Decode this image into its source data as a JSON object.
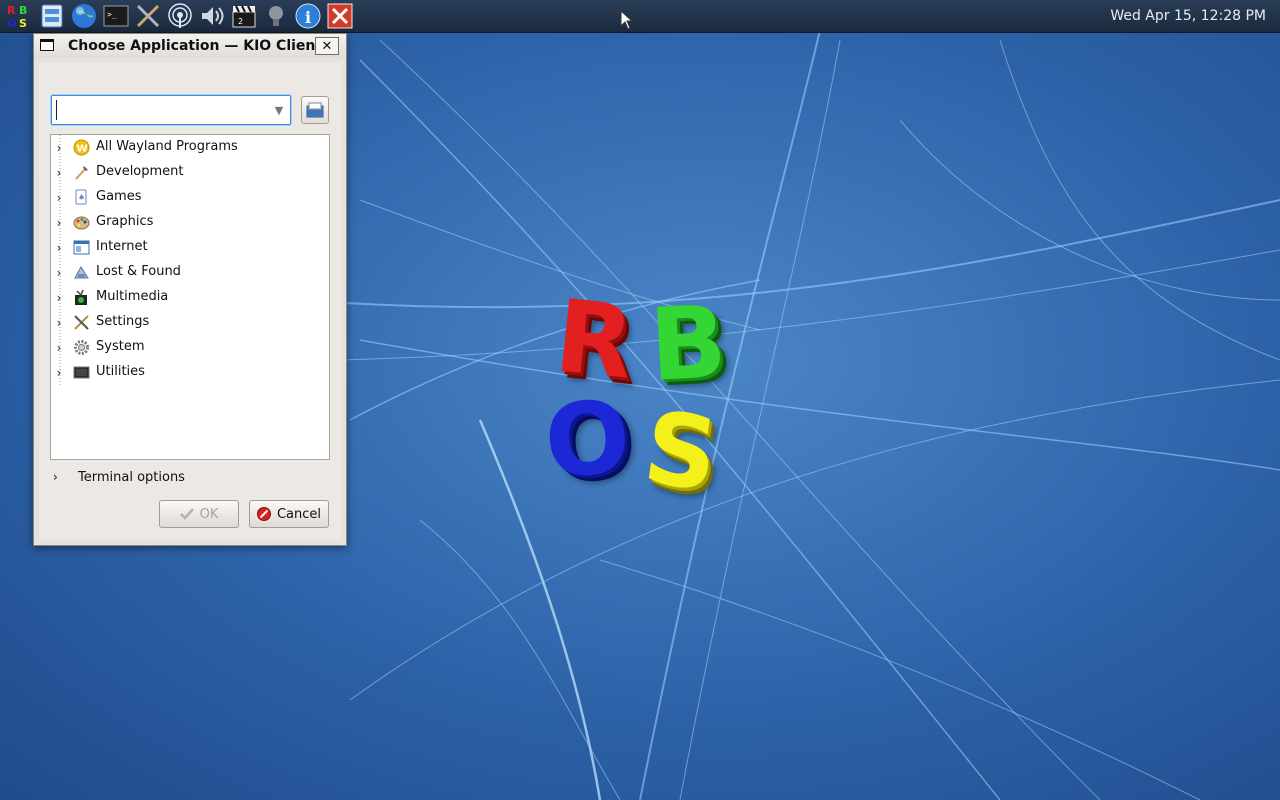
{
  "panel": {
    "launchers": [
      {
        "icon": "rbos-menu-icon"
      },
      {
        "icon": "file-manager-icon"
      },
      {
        "icon": "web-browser-icon"
      },
      {
        "icon": "terminal-icon"
      },
      {
        "icon": "settings-tools-icon"
      },
      {
        "icon": "network-icon"
      },
      {
        "icon": "volume-icon"
      },
      {
        "icon": "media-clapperboard-icon"
      },
      {
        "icon": "lightbulb-icon"
      },
      {
        "icon": "info-icon"
      },
      {
        "icon": "close-x-icon"
      }
    ],
    "clock": "Wed Apr 15, 12:28 PM"
  },
  "logo": {
    "r": "R",
    "b": "B",
    "o": "O",
    "s": "S"
  },
  "dialog": {
    "title": "Choose Application — KIO Client",
    "close_label": "✕",
    "combo": {
      "value": "",
      "placeholder": ""
    },
    "categories": [
      {
        "label": "All Wayland Programs",
        "icon": "wayland-icon"
      },
      {
        "label": "Development",
        "icon": "development-icon"
      },
      {
        "label": "Games",
        "icon": "games-icon"
      },
      {
        "label": "Graphics",
        "icon": "graphics-palette-icon"
      },
      {
        "label": "Internet",
        "icon": "internet-icon"
      },
      {
        "label": "Lost & Found",
        "icon": "lost-found-icon"
      },
      {
        "label": "Multimedia",
        "icon": "multimedia-icon"
      },
      {
        "label": "Settings",
        "icon": "settings-icon"
      },
      {
        "label": "System",
        "icon": "system-gear-icon"
      },
      {
        "label": "Utilities",
        "icon": "utilities-icon"
      }
    ],
    "terminal_options": "Terminal options",
    "ok_label": "OK",
    "cancel_label": "Cancel"
  },
  "colors": {
    "panel": "#1f3049",
    "desktop": "#2f63a6",
    "dialog_bg": "#e6e2dd",
    "focus_blue": "#3a8ee6"
  }
}
